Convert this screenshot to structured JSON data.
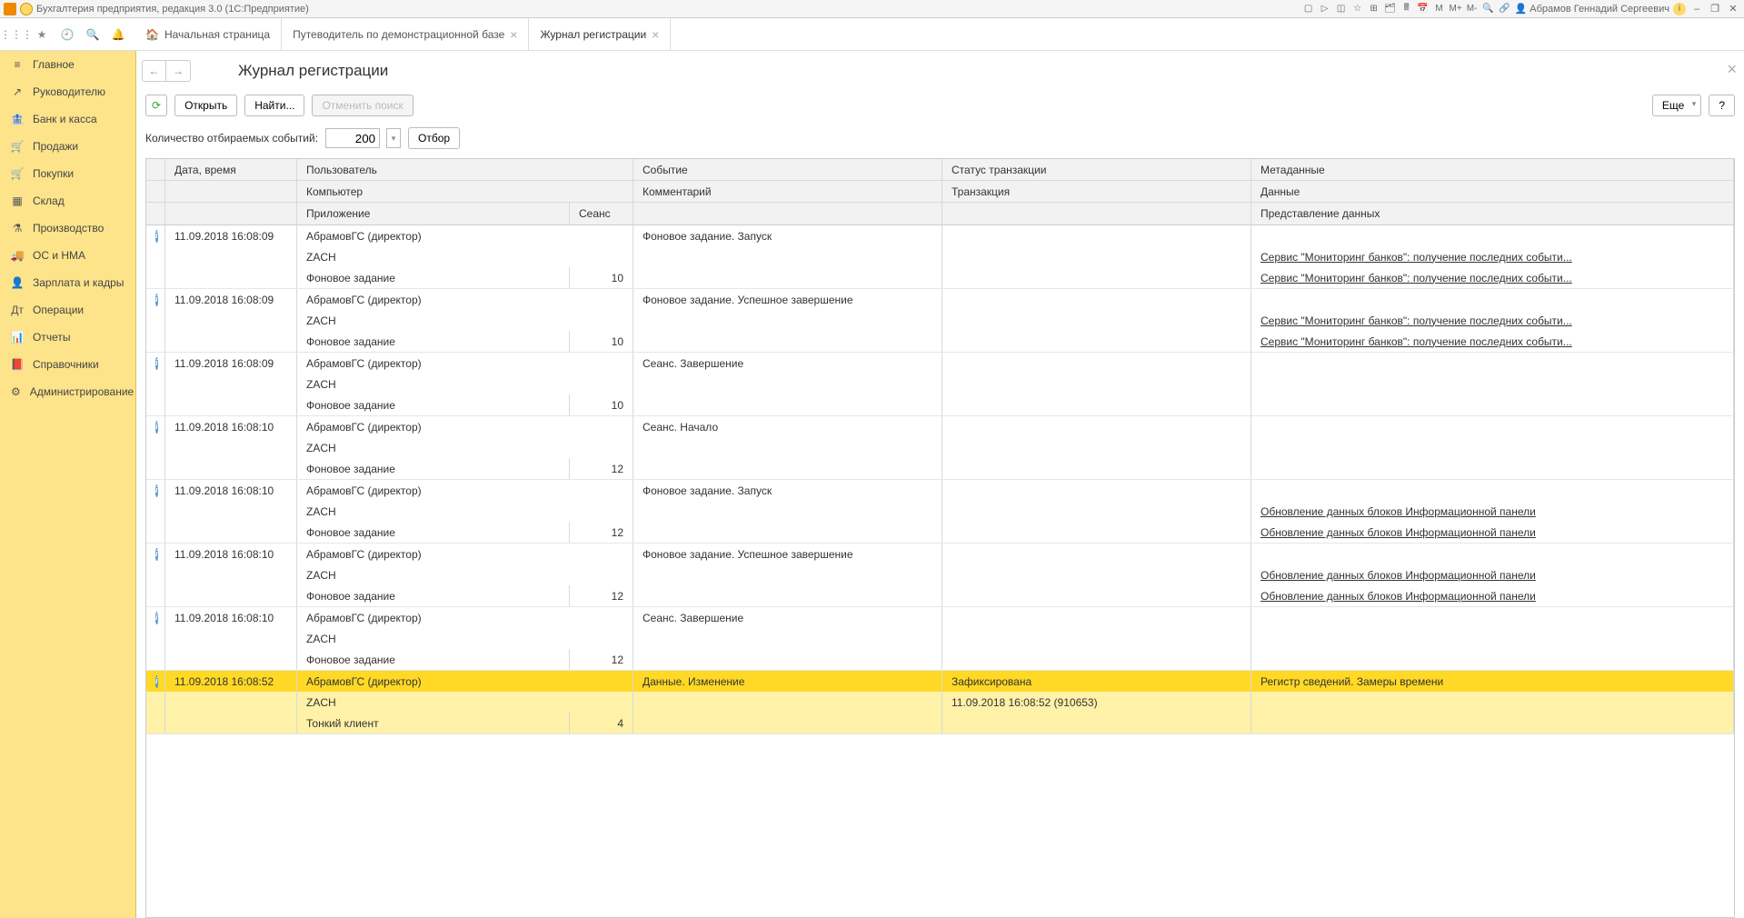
{
  "titlebar": {
    "app_title": "Бухгалтерия предприятия, редакция 3.0  (1С:Предприятие)",
    "tb_m": "M",
    "tb_mplus": "M+",
    "tb_mminus": "M-",
    "user": "Абрамов Геннадий Сергеевич"
  },
  "tabs": [
    {
      "label": "Начальная страница",
      "closable": false,
      "home": true
    },
    {
      "label": "Путеводитель по демонстрационной базе",
      "closable": true
    },
    {
      "label": "Журнал регистрации",
      "closable": true,
      "active": true
    }
  ],
  "sidebar": [
    {
      "label": "Главное",
      "icon": "≡"
    },
    {
      "label": "Руководителю",
      "icon": "↗"
    },
    {
      "label": "Банк и касса",
      "icon": "🏦"
    },
    {
      "label": "Продажи",
      "icon": "🛒"
    },
    {
      "label": "Покупки",
      "icon": "🛒"
    },
    {
      "label": "Склад",
      "icon": "▦"
    },
    {
      "label": "Производство",
      "icon": "⚗"
    },
    {
      "label": "ОС и НМА",
      "icon": "🚚"
    },
    {
      "label": "Зарплата и кадры",
      "icon": "👤"
    },
    {
      "label": "Операции",
      "icon": "Дт"
    },
    {
      "label": "Отчеты",
      "icon": "📊"
    },
    {
      "label": "Справочники",
      "icon": "📕"
    },
    {
      "label": "Администрирование",
      "icon": "⚙"
    }
  ],
  "page": {
    "title": "Журнал регистрации",
    "btn_open": "Открыть",
    "btn_find": "Найти...",
    "btn_cancel_search": "Отменить поиск",
    "btn_more": "Еще",
    "btn_help": "?",
    "filter_label": "Количество отбираемых событий:",
    "filter_count": "200",
    "btn_filter": "Отбор"
  },
  "columns": {
    "date": "Дата, время",
    "user": "Пользователь",
    "computer": "Компьютер",
    "app": "Приложение",
    "session": "Сеанс",
    "event": "Событие",
    "comment": "Комментарий",
    "status": "Статус транзакции",
    "transaction": "Транзакция",
    "metadata": "Метаданные",
    "data": "Данные",
    "data_repr": "Представление данных"
  },
  "rows": [
    {
      "date": "11.09.2018 16:08:09",
      "user": "АбрамовГС (директор)",
      "computer": "ZACH",
      "app": "Фоновое задание",
      "session": "10",
      "event": "Фоновое задание. Запуск",
      "comment": "",
      "status": "",
      "transaction": "",
      "metadata": "",
      "data": "Сервис \"Мониторинг банков\": получение последних событи...",
      "data_repr": "Сервис \"Мониторинг банков\": получение последних событи..."
    },
    {
      "date": "11.09.2018 16:08:09",
      "user": "АбрамовГС (директор)",
      "computer": "ZACH",
      "app": "Фоновое задание",
      "session": "10",
      "event": "Фоновое задание. Успешное завершение",
      "comment": "",
      "status": "",
      "transaction": "",
      "metadata": "",
      "data": "Сервис \"Мониторинг банков\": получение последних событи...",
      "data_repr": "Сервис \"Мониторинг банков\": получение последних событи..."
    },
    {
      "date": "11.09.2018 16:08:09",
      "user": "АбрамовГС (директор)",
      "computer": "ZACH",
      "app": "Фоновое задание",
      "session": "10",
      "event": "Сеанс. Завершение",
      "comment": "",
      "status": "",
      "transaction": "",
      "metadata": "",
      "data": "",
      "data_repr": ""
    },
    {
      "date": "11.09.2018 16:08:10",
      "user": "АбрамовГС (директор)",
      "computer": "ZACH",
      "app": "Фоновое задание",
      "session": "12",
      "event": "Сеанс. Начало",
      "comment": "",
      "status": "",
      "transaction": "",
      "metadata": "",
      "data": "",
      "data_repr": ""
    },
    {
      "date": "11.09.2018 16:08:10",
      "user": "АбрамовГС (директор)",
      "computer": "ZACH",
      "app": "Фоновое задание",
      "session": "12",
      "event": "Фоновое задание. Запуск",
      "comment": "",
      "status": "",
      "transaction": "",
      "metadata": "",
      "data": "Обновление данных блоков Информационной панели",
      "data_repr": "Обновление данных блоков Информационной панели"
    },
    {
      "date": "11.09.2018 16:08:10",
      "user": "АбрамовГС (директор)",
      "computer": "ZACH",
      "app": "Фоновое задание",
      "session": "12",
      "event": "Фоновое задание. Успешное завершение",
      "comment": "",
      "status": "",
      "transaction": "",
      "metadata": "",
      "data": "Обновление данных блоков Информационной панели",
      "data_repr": "Обновление данных блоков Информационной панели"
    },
    {
      "date": "11.09.2018 16:08:10",
      "user": "АбрамовГС (директор)",
      "computer": "ZACH",
      "app": "Фоновое задание",
      "session": "12",
      "event": "Сеанс. Завершение",
      "comment": "",
      "status": "",
      "transaction": "",
      "metadata": "",
      "data": "",
      "data_repr": ""
    },
    {
      "date": "11.09.2018 16:08:52",
      "user": "АбрамовГС (директор)",
      "computer": "ZACH",
      "app": "Тонкий клиент",
      "session": "4",
      "event": "Данные. Изменение",
      "comment": "",
      "status": "Зафиксирована",
      "transaction": "11.09.2018 16:08:52 (910653)",
      "metadata": "Регистр сведений. Замеры времени",
      "data": "",
      "data_repr": "",
      "selected": true
    }
  ]
}
